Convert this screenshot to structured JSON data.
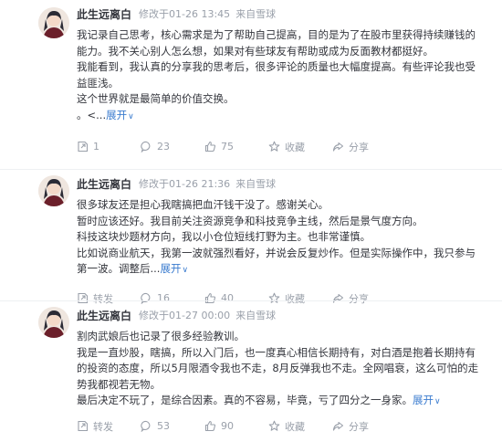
{
  "posts": [
    {
      "author": "此生远离白",
      "edited": "修改于01-26 13:45",
      "source": "来自雪球",
      "lines": [
        "我记录自己思考，核心需求是为了帮助自己提高，目的是为了在股市里获得持续赚钱的",
        "能力。我不关心别人怎么想，如果对有些球友有帮助或成为反面教材都挺好。",
        "我能看到，我认真的分享我的思考后，很多评论的质量也大幅度提高。有些评论我也受",
        "益匪浅。",
        "这个世界就是最简单的价值交换。"
      ],
      "tail": "。<...",
      "expand": "展开",
      "retweet": "1",
      "comments": "23",
      "likes": "75",
      "favorite": "收藏",
      "share": "分享"
    },
    {
      "author": "此生远离白",
      "edited": "修改于01-26 21:36",
      "source": "来自雪球",
      "lines": [
        "很多球友还是担心我瞎搞把血汗钱干没了。感谢关心。",
        "暂时应该还好。我目前关注资源竞争和科技竞争主线，然后是景气度方向。",
        "科技这块炒题材方向，我以小仓位短线打野为主。也非常谨慎。",
        "比如说商业航天，我第一波就强烈看好，并说会反复炒作。但是实际操作中，我只参与",
        "第一波。调整后..."
      ],
      "tail": "",
      "expand": "展开",
      "retweet": "转发",
      "comments": "16",
      "likes": "40",
      "favorite": "收藏",
      "share": "分享"
    },
    {
      "author": "此生远离白",
      "edited": "修改于01-27 00:00",
      "source": "来自雪球",
      "lines": [
        "割肉武娘后也记录了很多经验教训。",
        "我是一直炒股，瞎搞，所以入门后，也一度真心相信长期持有，对白酒是抱着长期持有",
        "的投资的态度，所以5月限酒令我也不走，8月反弹我也不走。全网唱衰，这么可怕的走",
        "势我都视若无物。",
        "最后决定不玩了，是综合因素。真的不容易，毕竟，亏了四分之一身家。"
      ],
      "tail": "",
      "expand": "展开",
      "retweet": "转发",
      "comments": "53",
      "likes": "90",
      "favorite": "收藏",
      "share": "分享"
    }
  ],
  "colors": {
    "link": "#3b7ccf",
    "meta": "#9aa0aa",
    "text": "#33353c"
  }
}
